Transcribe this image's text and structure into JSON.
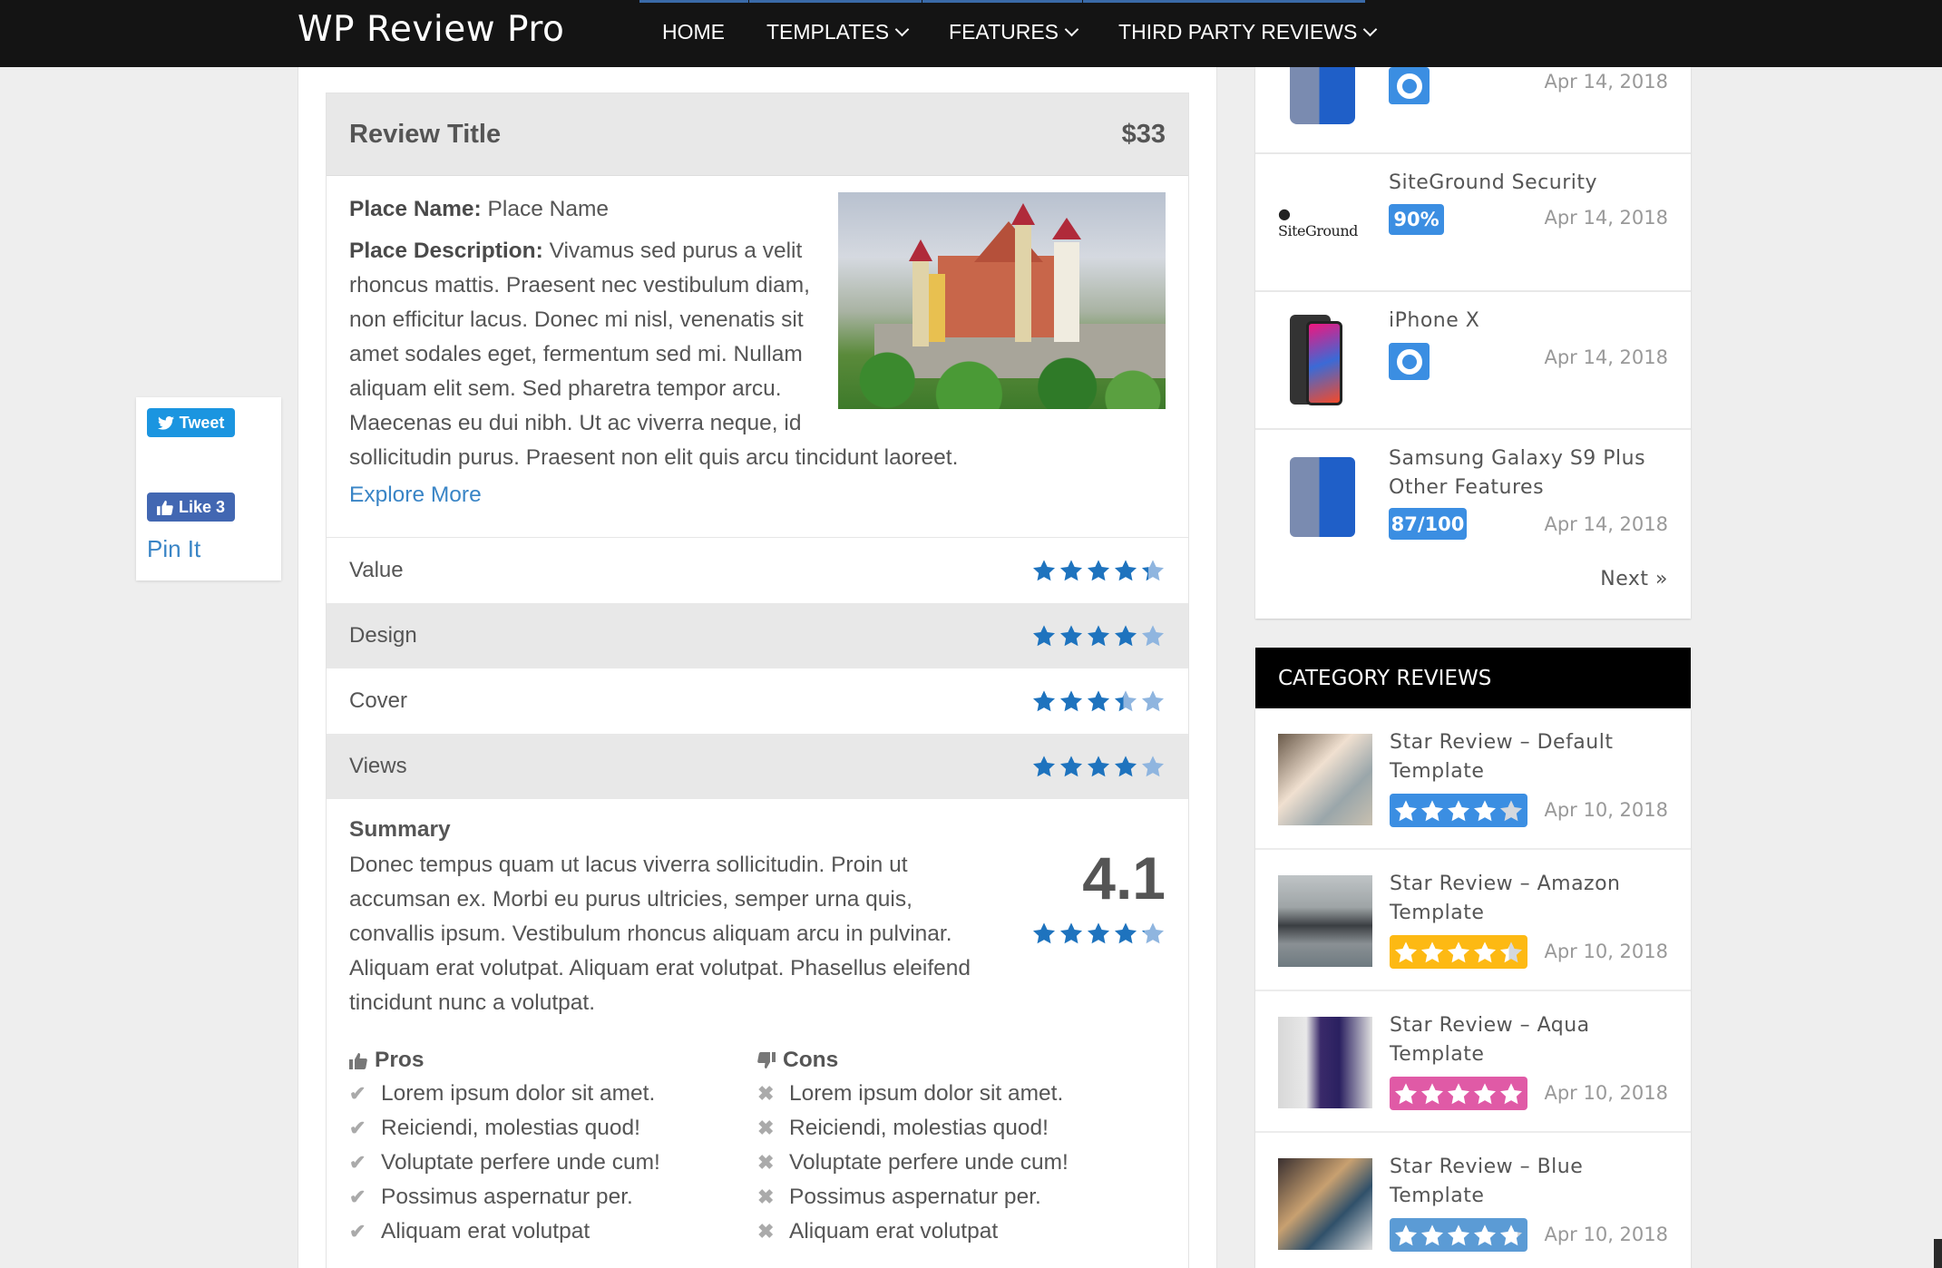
{
  "navbar": {
    "logo": "WP Review Pro",
    "items": [
      {
        "label": "HOME",
        "has_dropdown": false
      },
      {
        "label": "TEMPLATES",
        "has_dropdown": true
      },
      {
        "label": "FEATURES",
        "has_dropdown": true
      },
      {
        "label": "THIRD PARTY REVIEWS",
        "has_dropdown": true
      }
    ],
    "accent_color": "#3a6aa8"
  },
  "social": {
    "tweet_label": "Tweet",
    "like_label": "Like 3",
    "pin_label": "Pin It"
  },
  "review": {
    "title": "Review Title",
    "price": "$33",
    "place_name_label": "Place Name:",
    "place_name_value": "Place Name",
    "place_description_label": "Place Description:",
    "place_description_value": "Vivamus sed purus a velit rhoncus mattis. Praesent nec vestibulum diam, non efficitur lacus. Donec mi nisl, venenatis sit amet sodales eget, fermentum sed mi. Nullam aliquam elit sem. Sed pharetra tempor arcu. Maecenas eu dui nibh. Ut ac viverra neque, id sollicitudin purus. Praesent non elit quis arcu tincidunt laoreet.",
    "image_alt": "castle",
    "explore_label": "Explore More",
    "star_color": "#1e73be",
    "criteria": [
      {
        "label": "Value",
        "rating": 4.3
      },
      {
        "label": "Design",
        "rating": 4.0
      },
      {
        "label": "Cover",
        "rating": 3.4
      },
      {
        "label": "Views",
        "rating": 4.0
      }
    ],
    "summary_title": "Summary",
    "summary_text": "Donec tempus quam ut lacus viverra sollicitudin. Proin ut accumsan ex. Morbi eu purus ultricies, semper urna quis, convallis ipsum. Vestibulum rhoncus aliquam arcu in pulvinar. Aliquam erat volutpat. Aliquam erat volutpat. Phasellus eleifend tincidunt nunc a volutpat.",
    "total_score": "4.1",
    "total_rating": 4.1,
    "pros_title": "Pros",
    "cons_title": "Cons",
    "pros": [
      "Lorem ipsum dolor sit amet.",
      "Reiciendi, molestias quod!",
      "Voluptate perfere unde cum!",
      "Possimus aspernatur per.",
      "Aliquam erat volutpat"
    ],
    "cons": [
      "Lorem ipsum dolor sit amet.",
      "Reiciendi, molestias quod!",
      "Voluptate perfere unde cum!",
      "Possimus aspernatur per.",
      "Aliquam erat volutpat"
    ]
  },
  "sidebar": {
    "recent": [
      {
        "title": "",
        "badge_type": "circle",
        "badge_value": 0.97,
        "date": "Apr 14, 2018",
        "thumb": "samsung-phone"
      },
      {
        "title": "SiteGround Security",
        "badge_type": "text",
        "badge_text": "90%",
        "date": "Apr 14, 2018",
        "thumb": "siteground-logo"
      },
      {
        "title": "iPhone X",
        "badge_type": "circle",
        "badge_value": 0.97,
        "date": "Apr 14, 2018",
        "thumb": "iphone"
      },
      {
        "title": "Samsung Galaxy S9 Plus Other Features",
        "badge_type": "text",
        "badge_text": "87/100",
        "date": "Apr 14, 2018",
        "thumb": "samsung-phone"
      }
    ],
    "siteground_logo_text": "SiteGround",
    "next_label": "Next »",
    "badge_color": "#3b8ee2",
    "category_title": "CATEGORY REVIEWS",
    "category_items": [
      {
        "title": "Star Review – Default Template",
        "rating": 4.0,
        "badge_color": "#3b8ee2",
        "date": "Apr 10, 2018",
        "thumb": "woman-laptop"
      },
      {
        "title": "Star Review – Amazon Template",
        "rating": 4.4,
        "badge_color": "#fdb913",
        "date": "Apr 10, 2018",
        "thumb": "mountains"
      },
      {
        "title": "Star Review – Aqua Template",
        "rating": 5.0,
        "badge_color": "#e05aa6",
        "date": "Apr 10, 2018",
        "thumb": "fashion-legs"
      },
      {
        "title": "Star Review – Blue Template",
        "rating": 4.8,
        "badge_color": "#5b9bd5",
        "date": "Apr 10, 2018",
        "thumb": "man-sitting"
      }
    ]
  }
}
